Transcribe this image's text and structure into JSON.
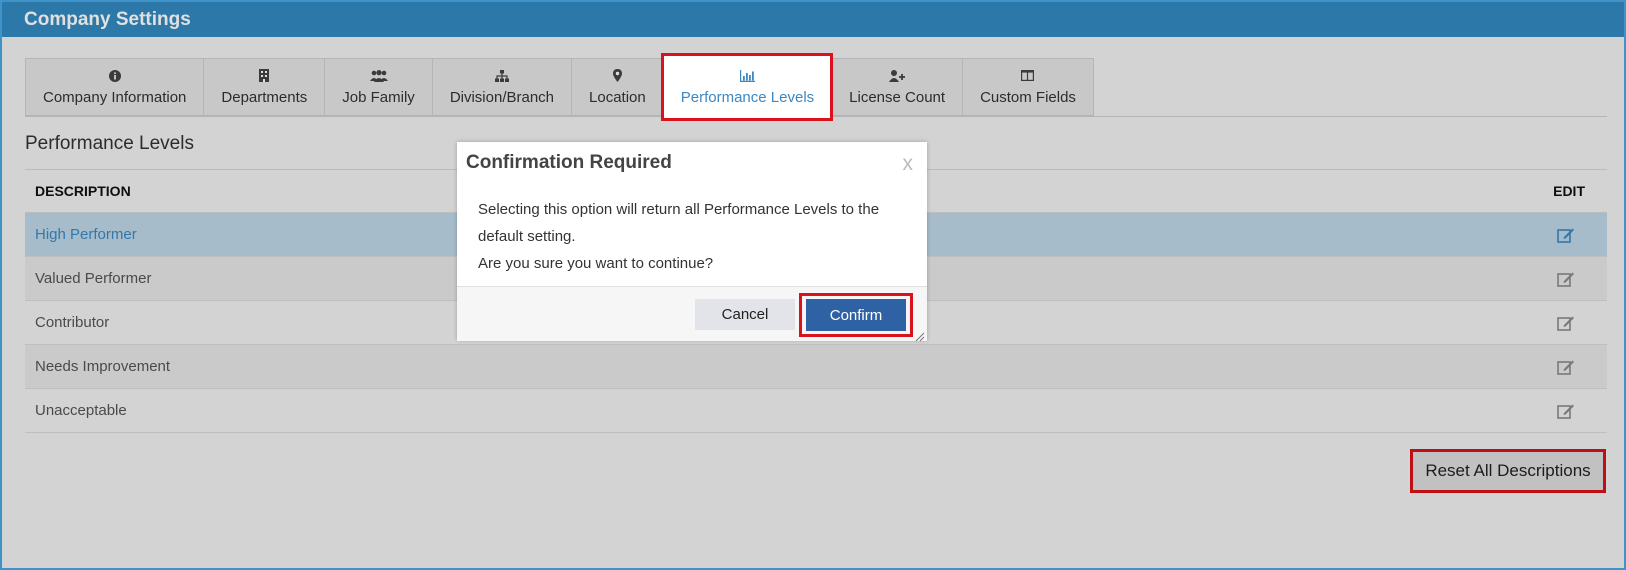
{
  "window": {
    "title": "Company Settings"
  },
  "tabs": [
    {
      "label": "Company Information",
      "icon": "info-circle-icon"
    },
    {
      "label": "Departments",
      "icon": "building-icon"
    },
    {
      "label": "Job Family",
      "icon": "users-icon"
    },
    {
      "label": "Division/Branch",
      "icon": "sitemap-icon"
    },
    {
      "label": "Location",
      "icon": "map-marker-icon"
    },
    {
      "label": "Performance Levels",
      "icon": "bar-chart-icon",
      "active": true
    },
    {
      "label": "License Count",
      "icon": "user-plus-icon"
    },
    {
      "label": "Custom Fields",
      "icon": "columns-icon"
    }
  ],
  "section": {
    "title": "Performance Levels"
  },
  "table": {
    "headers": {
      "description": "DESCRIPTION",
      "edit": "EDIT"
    },
    "rows": [
      {
        "description": "High Performer",
        "selected": true
      },
      {
        "description": "Valued Performer"
      },
      {
        "description": "Contributor"
      },
      {
        "description": "Needs Improvement"
      },
      {
        "description": "Unacceptable"
      }
    ]
  },
  "reset_button": {
    "label": "Reset All Descriptions"
  },
  "dialog": {
    "title": "Confirmation Required",
    "close_label": "x",
    "message_line1": "Selecting this option will return all Performance Levels to the default setting.",
    "message_line2": "Are you sure you want to continue?",
    "cancel_label": "Cancel",
    "confirm_label": "Confirm"
  },
  "colors": {
    "header_blue": "#3389c0",
    "accent_blue": "#3b88c3",
    "confirm_blue": "#2f62a4",
    "highlight_red": "#d9121b",
    "selected_row": "#bed7e6"
  }
}
